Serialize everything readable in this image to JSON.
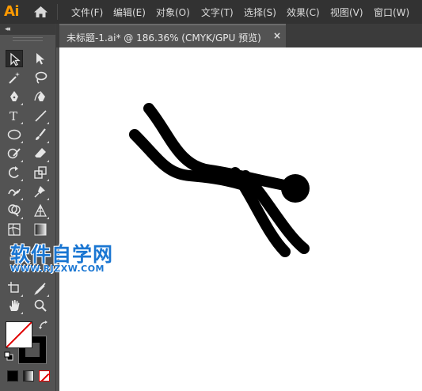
{
  "app": {
    "logo": "Ai"
  },
  "menu": [
    {
      "label": "文件(F)"
    },
    {
      "label": "编辑(E)"
    },
    {
      "label": "对象(O)"
    },
    {
      "label": "文字(T)"
    },
    {
      "label": "选择(S)"
    },
    {
      "label": "效果(C)"
    },
    {
      "label": "视图(V)"
    },
    {
      "label": "窗口(W)"
    }
  ],
  "document": {
    "tab_label": "未标题-1.ai* @ 186.36% (CMYK/GPU 预览)",
    "close_glyph": "×"
  },
  "toolbar": {
    "collapse_glyph": "◂◂",
    "tools": [
      {
        "name": "selection-tool",
        "icon": "selection-arrow-icon"
      },
      {
        "name": "direct-selection-tool",
        "icon": "direct-selection-arrow-icon"
      },
      {
        "name": "magic-wand-tool",
        "icon": "magic-wand-icon"
      },
      {
        "name": "lasso-tool",
        "icon": "lasso-icon"
      },
      {
        "name": "pen-tool",
        "icon": "pen-icon"
      },
      {
        "name": "curvature-tool",
        "icon": "curvature-pen-icon"
      },
      {
        "name": "type-tool",
        "icon": "type-icon",
        "glyph": "T"
      },
      {
        "name": "line-segment-tool",
        "icon": "line-segment-icon"
      },
      {
        "name": "ellipse-tool",
        "icon": "ellipse-icon"
      },
      {
        "name": "paintbrush-tool",
        "icon": "paintbrush-icon"
      },
      {
        "name": "shaper-tool",
        "icon": "shaper-icon"
      },
      {
        "name": "eraser-tool",
        "icon": "eraser-icon"
      },
      {
        "name": "rotate-tool",
        "icon": "rotate-icon"
      },
      {
        "name": "scale-tool",
        "icon": "scale-icon"
      },
      {
        "name": "warp-tool",
        "icon": "warp-icon"
      },
      {
        "name": "puppet-warp-tool",
        "icon": "pushpin-icon"
      },
      {
        "name": "shape-builder-tool",
        "icon": "shape-builder-icon"
      },
      {
        "name": "perspective-grid-tool",
        "icon": "perspective-grid-icon"
      },
      {
        "name": "mesh-tool",
        "icon": "mesh-icon"
      },
      {
        "name": "gradient-tool",
        "icon": "gradient-icon"
      },
      {
        "name": "artboard-tool",
        "icon": "artboard-icon"
      },
      {
        "name": "eyedropper-tool",
        "icon": "eyedropper-icon"
      },
      {
        "name": "hand-tool",
        "icon": "hand-icon"
      },
      {
        "name": "zoom-tool",
        "icon": "magnifier-icon"
      }
    ],
    "fill": "none",
    "stroke": "#000000"
  },
  "watermark": {
    "title": "软件自学网",
    "url": "WWW.RJZXW.COM"
  },
  "colors": {
    "menubar": "#323232",
    "panel": "#535353",
    "canvas": "#ffffff",
    "app_accent": "#ff9a00",
    "watermark": "#1a76d2"
  }
}
